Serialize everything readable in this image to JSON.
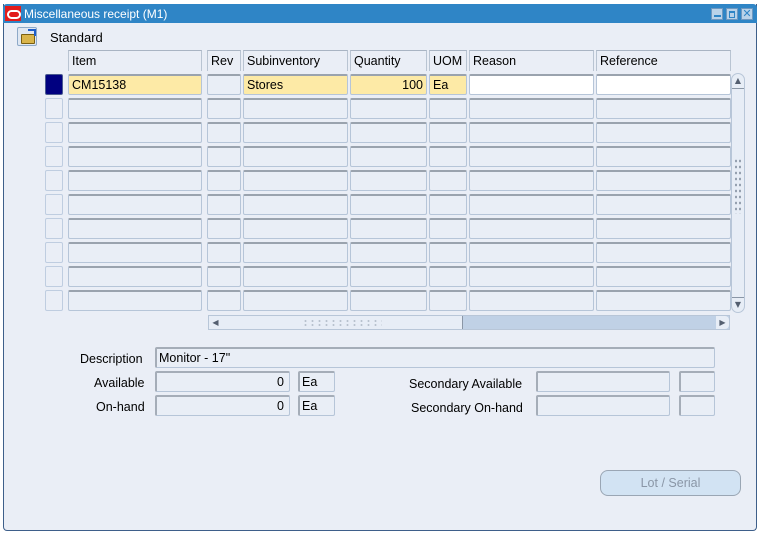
{
  "window": {
    "title": "Miscellaneous receipt (M1)",
    "controls": [
      "minimize",
      "maximize",
      "close"
    ],
    "close_glyph": "✕"
  },
  "toolbar": {
    "open_icon": "folder-open-icon",
    "type_label": "Standard"
  },
  "table": {
    "columns": [
      "Item",
      "Rev",
      "Subinventory",
      "Quantity",
      "UOM",
      "Reason",
      "Reference"
    ],
    "rows": [
      {
        "item": "CM15138",
        "rev": "",
        "subinventory": "Stores",
        "quantity": "100",
        "uom": "Ea",
        "reason": "",
        "reference": "",
        "selected": true
      },
      {
        "item": "",
        "rev": "",
        "subinventory": "",
        "quantity": "",
        "uom": "",
        "reason": "",
        "reference": ""
      },
      {
        "item": "",
        "rev": "",
        "subinventory": "",
        "quantity": "",
        "uom": "",
        "reason": "",
        "reference": ""
      },
      {
        "item": "",
        "rev": "",
        "subinventory": "",
        "quantity": "",
        "uom": "",
        "reason": "",
        "reference": ""
      },
      {
        "item": "",
        "rev": "",
        "subinventory": "",
        "quantity": "",
        "uom": "",
        "reason": "",
        "reference": ""
      },
      {
        "item": "",
        "rev": "",
        "subinventory": "",
        "quantity": "",
        "uom": "",
        "reason": "",
        "reference": ""
      },
      {
        "item": "",
        "rev": "",
        "subinventory": "",
        "quantity": "",
        "uom": "",
        "reason": "",
        "reference": ""
      },
      {
        "item": "",
        "rev": "",
        "subinventory": "",
        "quantity": "",
        "uom": "",
        "reason": "",
        "reference": ""
      },
      {
        "item": "",
        "rev": "",
        "subinventory": "",
        "quantity": "",
        "uom": "",
        "reason": "",
        "reference": ""
      },
      {
        "item": "",
        "rev": "",
        "subinventory": "",
        "quantity": "",
        "uom": "",
        "reason": "",
        "reference": ""
      }
    ],
    "scroll_up_glyph": "▲",
    "scroll_down_glyph": "▼",
    "scroll_left_glyph": "◀",
    "scroll_right_glyph": "▶"
  },
  "details": {
    "description_label": "Description",
    "description_value": "Monitor - 17\"",
    "available_label": "Available",
    "available_value": "0",
    "available_uom": "Ea",
    "onhand_label": "On-hand",
    "onhand_value": "0",
    "onhand_uom": "Ea",
    "secondary_available_label": "Secondary Available",
    "secondary_available_value": "",
    "secondary_available_uom": "",
    "secondary_onhand_label": "Secondary On-hand",
    "secondary_onhand_value": "",
    "secondary_onhand_uom": ""
  },
  "buttons": {
    "lot_serial": "Lot / Serial"
  },
  "colors": {
    "titlebar": "#2f85c6",
    "window_bg": "#eaeef6",
    "current_record_field": "#fdeaa6",
    "row_indicator_active": "#000080"
  }
}
